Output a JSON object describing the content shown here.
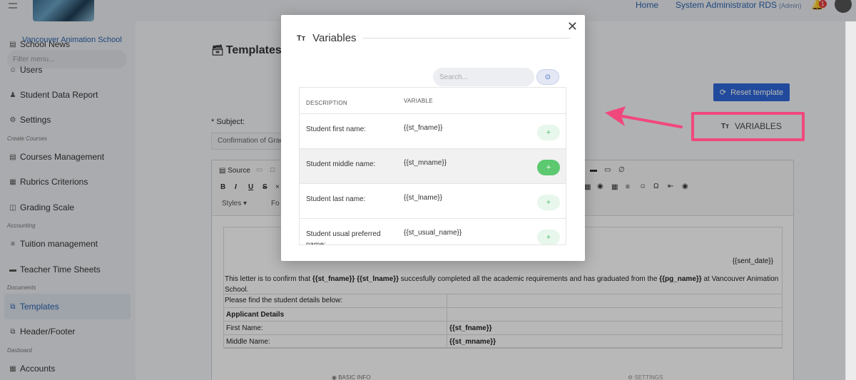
{
  "topbar": {
    "home": "Home",
    "user": "System Administrator RDS",
    "role": "(Admin)",
    "notifications": "1"
  },
  "sidebar": {
    "school": "Vancouver Animation School",
    "filter_placeholder": "Filter menu...",
    "items": [
      {
        "label": "School News",
        "icon": "news-icon"
      },
      {
        "label": "Users",
        "icon": "users-icon"
      },
      {
        "label": "Student Data Report",
        "icon": "user-icon"
      },
      {
        "label": "Settings",
        "icon": "gear-icon"
      },
      {
        "label": "Courses Management",
        "icon": "list-icon"
      },
      {
        "label": "Rubrics Criterions",
        "icon": "grid-icon"
      },
      {
        "label": "Grading Scale",
        "icon": "table-icon"
      },
      {
        "label": "Tuition management",
        "icon": "list-icon"
      },
      {
        "label": "Teacher Time Sheets",
        "icon": "sheet-icon"
      },
      {
        "label": "Templates",
        "icon": "copy-icon"
      },
      {
        "label": "Header/Footer",
        "icon": "copy-icon"
      },
      {
        "label": "Accounts",
        "icon": "grid-icon"
      }
    ],
    "sections": [
      "Create Courses",
      "Accounting",
      "Documents",
      "Dasboard"
    ]
  },
  "main": {
    "title": "Templates",
    "reset_button": "Reset template",
    "subject_label": "* Subject:",
    "subject_value": "Confirmation of Grad",
    "variables_button": "VARIABLES",
    "toolbar": {
      "source": "Source",
      "styles": "Styles",
      "format": "Fo"
    },
    "letter": {
      "sent_date": "{{sent_date}}",
      "line1_a": "This letter is to confirm that ",
      "line1_b": "{{st_fname}} {{st_lname}}",
      "line1_c": " succesfully completed all the academic requirements and has graduated from the ",
      "line1_d": "{{pg_name}}",
      "line1_e": " at Vancouver Animation School.",
      "line2": "Please find the student details below:",
      "applicant_header": "Applicant Details",
      "first_name_label": "First Name:",
      "first_name_value": "{{st_fname}}",
      "middle_name_label": "Middle Name:",
      "middle_name_value": "{{st_mname}}"
    },
    "bottom_tabs": {
      "basic": "BASIC INFO",
      "settings": "SETTINGS"
    }
  },
  "modal": {
    "title": "Variables",
    "search_placeholder": "Search...",
    "col_description": "DESCRIPTION",
    "col_variable": "VARIABLE",
    "rows": [
      {
        "description": "Student first name:",
        "variable": "{{st_fname}}"
      },
      {
        "description": "Student middle name:",
        "variable": "{{st_mname}}"
      },
      {
        "description": "Student last name:",
        "variable": "{{st_lname}}"
      },
      {
        "description": "Student usual preferred name:",
        "variable": "{{st_usual_name}}"
      }
    ],
    "add_label": "+"
  },
  "colors": {
    "accent": "#2f67d8",
    "highlight": "#f0487d",
    "add_green": "#5cc970"
  }
}
